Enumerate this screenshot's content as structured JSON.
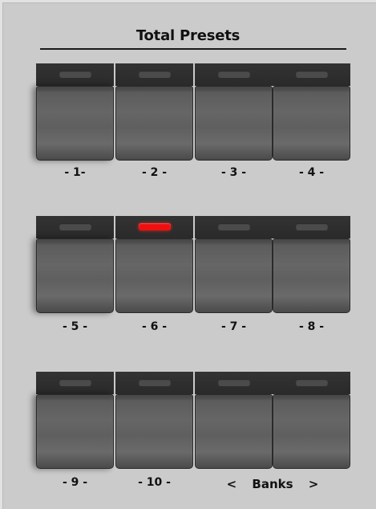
{
  "panel": {
    "title": "Total Presets"
  },
  "presets": [
    {
      "label": "- 1-",
      "led_on": false
    },
    {
      "label": "- 2 -",
      "led_on": false
    },
    {
      "label": "- 3 -",
      "led_on": false
    },
    {
      "label": "- 4 -",
      "led_on": false
    },
    {
      "label": "- 5 -",
      "led_on": false
    },
    {
      "label": "- 6 -",
      "led_on": true
    },
    {
      "label": "- 7 -",
      "led_on": false
    },
    {
      "label": "- 8 -",
      "led_on": false
    },
    {
      "label": "- 9 -",
      "led_on": false
    },
    {
      "label": "- 10 -",
      "led_on": false
    },
    {
      "led_on": false
    },
    {
      "led_on": false
    }
  ],
  "banks": {
    "prev_label": "<",
    "label": "Banks",
    "next_label": ">"
  },
  "colors": {
    "led_on": "#ee1010",
    "led_off": "#4b4b4b",
    "panel_bg": "#cbcbcb"
  }
}
